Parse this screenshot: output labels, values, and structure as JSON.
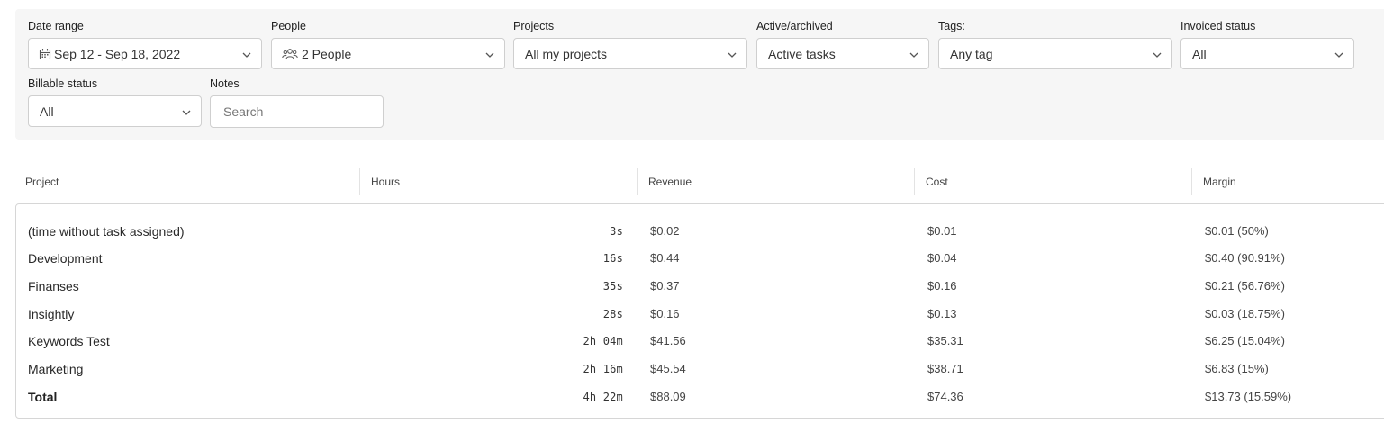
{
  "filters": {
    "date_range": {
      "label": "Date range",
      "value": "Sep 12 - Sep 18, 2022"
    },
    "people": {
      "label": "People",
      "value": "2 People"
    },
    "projects": {
      "label": "Projects",
      "value": "All my projects"
    },
    "active_archived": {
      "label": "Active/archived",
      "value": "Active tasks"
    },
    "tags": {
      "label": "Tags:",
      "value": "Any tag"
    },
    "invoiced_status": {
      "label": "Invoiced status",
      "value": "All"
    },
    "billable_status": {
      "label": "Billable status",
      "value": "All"
    },
    "notes": {
      "label": "Notes",
      "placeholder": "Search",
      "value": ""
    }
  },
  "table": {
    "columns": [
      "Project",
      "Hours",
      "Revenue",
      "Cost",
      "Margin"
    ],
    "rows": [
      {
        "project": "(time without task assigned)",
        "hours": "3s",
        "revenue": "$0.02",
        "cost": "$0.01",
        "margin": "$0.01 (50%)"
      },
      {
        "project": "Development",
        "hours": "16s",
        "revenue": "$0.44",
        "cost": "$0.04",
        "margin": "$0.40 (90.91%)"
      },
      {
        "project": "Finanses",
        "hours": "35s",
        "revenue": "$0.37",
        "cost": "$0.16",
        "margin": "$0.21 (56.76%)"
      },
      {
        "project": "Insightly",
        "hours": "28s",
        "revenue": "$0.16",
        "cost": "$0.13",
        "margin": "$0.03 (18.75%)"
      },
      {
        "project": "Keywords Test",
        "hours": "2h 04m",
        "revenue": "$41.56",
        "cost": "$35.31",
        "margin": "$6.25 (15.04%)"
      },
      {
        "project": "Marketing",
        "hours": "2h 16m",
        "revenue": "$45.54",
        "cost": "$38.71",
        "margin": "$6.83 (15%)"
      }
    ],
    "total": {
      "project": "Total",
      "hours": "4h 22m",
      "revenue": "$88.09",
      "cost": "$74.36",
      "margin": "$13.73 (15.59%)"
    }
  },
  "icons": {
    "date_range": "calendar-icon",
    "people": "people-icon",
    "dropdown": "chevron-down-icon"
  },
  "colors": {
    "filter_panel_bg": "#f6f6f6",
    "border": "#cfcfcf",
    "text": "#333333"
  }
}
